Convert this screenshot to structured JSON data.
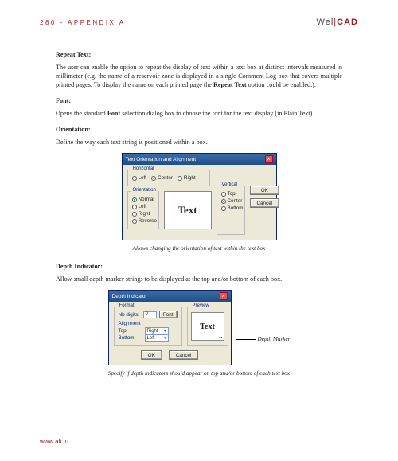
{
  "header": {
    "page_info": "280 - APPENDIX A",
    "logo_prefix": "Wel",
    "logo_suffix": "CAD"
  },
  "sections": {
    "repeat": {
      "title": "Repeat Text:",
      "body_a": "The user can enable the option to repeat the display of text within a text box at distinct intervals measured in millimeter (e.g. the name of a reservoir zone is displayed in a single Comment Log box that covers multiple printed pages. To display the name on each printed page the ",
      "body_bold": "Repeat Text",
      "body_b": " option could be enabled.)."
    },
    "font": {
      "title": "Font:",
      "body_a": "Opens the standard ",
      "body_bold": "Font",
      "body_b": " selection dialog box to choose the font for the text display (in Plain Text)."
    },
    "orientation": {
      "title": "Orientation:",
      "body": "Define the way each text string is positioned within a box."
    },
    "depth": {
      "title": "Depth Indicator:",
      "body": "Allow small depth marker strings to be displayed at the top and/or bottom of each box."
    }
  },
  "dialog1": {
    "title": "Text Orientation and Alignment",
    "groups": {
      "horizontal": {
        "title": "Horizontal",
        "opts": [
          "Left",
          "Center",
          "Right"
        ],
        "selected": "Center"
      },
      "orientation": {
        "title": "Orientation",
        "opts": [
          "Normal",
          "Left",
          "Right",
          "Reverse"
        ],
        "selected": "Normal"
      },
      "vertical": {
        "title": "Vertical",
        "opts": [
          "Top",
          "Center",
          "Bottom"
        ],
        "selected": "Center"
      }
    },
    "preview": "Text",
    "buttons": {
      "ok": "OK",
      "cancel": "Cancel"
    },
    "caption": "Allows changing the orientation of text within the text box"
  },
  "dialog2": {
    "title": "Depth Indicator",
    "format_group": "Format",
    "fields": {
      "nb_label": "Nb digits:",
      "nb_value": "0",
      "font_btn": "Font",
      "align_label": "Alignment",
      "top_label": "Top:",
      "top_value": "Right",
      "bottom_label": "Bottom:",
      "bottom_value": "Left"
    },
    "preview_group": "Preview",
    "preview": "Text",
    "depth_tick": "xx",
    "buttons": {
      "ok": "OK",
      "cancel": "Cancel"
    },
    "marker_label": "Depth Marker",
    "caption": "Specify if depth indicators should appear on top and/or bottom of each text box"
  },
  "footer": "www.alt.lu"
}
